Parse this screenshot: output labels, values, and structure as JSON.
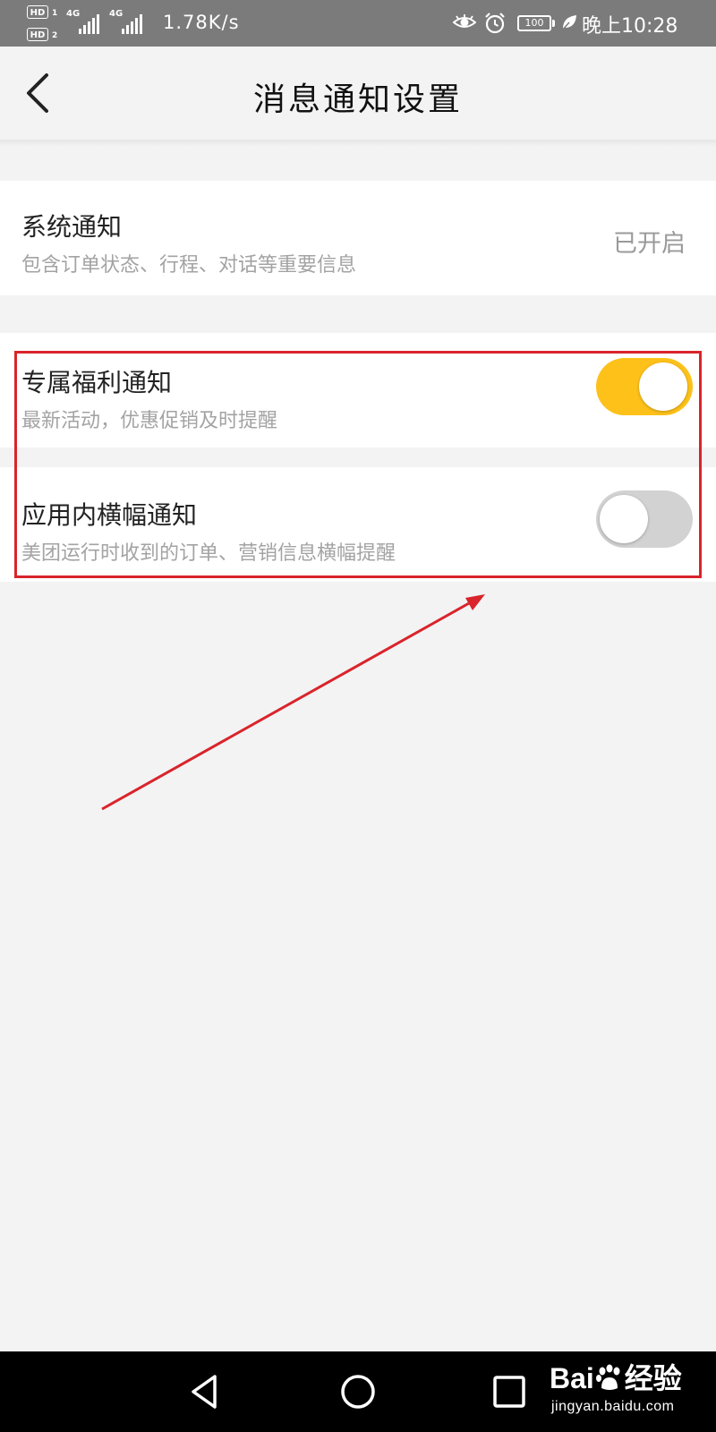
{
  "status_bar": {
    "hd1": "HD",
    "hd1_sim": "1",
    "hd2": "HD",
    "hd2_sim": "2",
    "net1": "4G",
    "net2": "4G",
    "speed": "1.78K/s",
    "battery": "100",
    "time": "晚上10:28",
    "icons": [
      "eye-icon",
      "alarm-icon",
      "battery-icon",
      "leaf-icon"
    ]
  },
  "header": {
    "title": "消息通知设置",
    "back_icon": "chevron-left-icon"
  },
  "settings": [
    {
      "title": "系统通知",
      "subtitle": "包含订单状态、行程、对话等重要信息",
      "status": "已开启"
    },
    {
      "title": "专属福利通知",
      "subtitle": "最新活动，优惠促销及时提醒",
      "toggle": true
    },
    {
      "title": "应用内横幅通知",
      "subtitle": "美团运行时收到的订单、营销信息横幅提醒",
      "toggle": false
    }
  ],
  "colors": {
    "toggle_on": "#fdc11a",
    "toggle_off": "#d2d2d2",
    "annotation": "#d9242b"
  },
  "nav_bar": {
    "icons": [
      "back-triangle-icon",
      "home-circle-icon",
      "recents-square-icon"
    ]
  },
  "watermark": {
    "brand_left": "Bai",
    "brand_right": "经验",
    "url": "jingyan.baidu.com"
  }
}
